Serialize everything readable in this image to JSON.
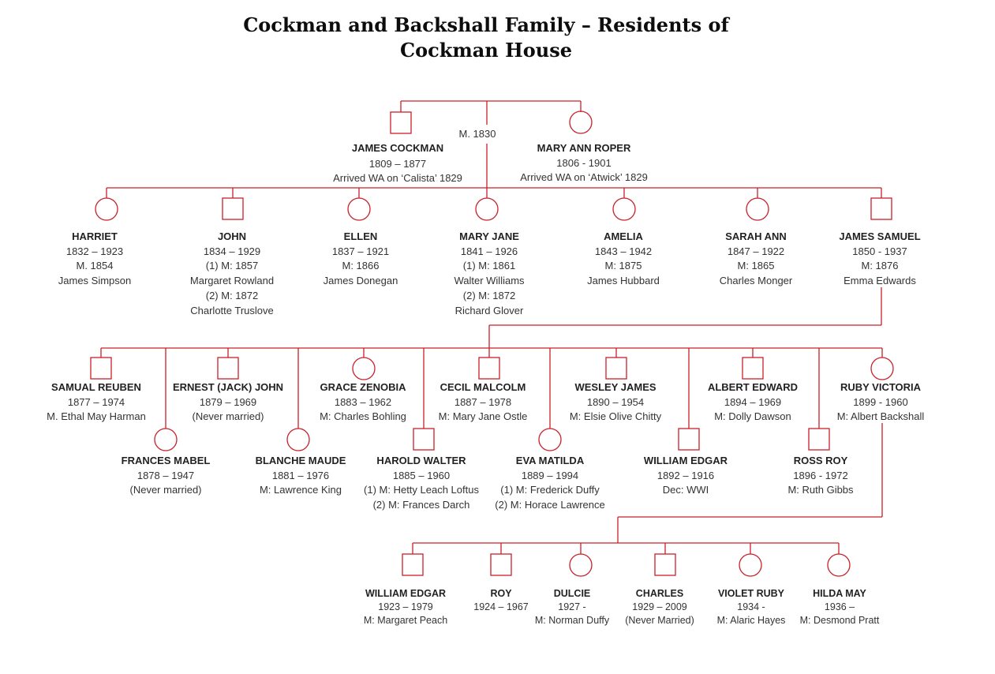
{
  "title_line1": "Cockman and Backshall Family – Residents of",
  "title_line2": "Cockman House",
  "line_color": "#c8202a",
  "founders": {
    "marriage": "M. 1830",
    "husband": {
      "name": "JAMES COCKMAN",
      "sex": "male",
      "lines": [
        "1809 – 1877",
        "Arrived WA on ‘Calista’ 1829"
      ]
    },
    "wife": {
      "name": "MARY ANN ROPER",
      "sex": "female",
      "lines": [
        "1806 - 1901",
        "Arrived WA on ‘Atwick’ 1829"
      ]
    }
  },
  "generation2": [
    {
      "name": "HARRIET",
      "sex": "female",
      "lines": [
        "1832 – 1923",
        "M. 1854",
        "James Simpson"
      ]
    },
    {
      "name": "JOHN",
      "sex": "male",
      "lines": [
        "1834 – 1929",
        "(1) M: 1857",
        "Margaret Rowland",
        "(2) M: 1872",
        "Charlotte Truslove"
      ]
    },
    {
      "name": "ELLEN",
      "sex": "female",
      "lines": [
        "1837 – 1921",
        "M: 1866",
        "James Donegan"
      ]
    },
    {
      "name": "MARY JANE",
      "sex": "female",
      "lines": [
        "1841 – 1926",
        "(1) M: 1861",
        "Walter Williams",
        "(2) M: 1872",
        "Richard Glover"
      ]
    },
    {
      "name": "AMELIA",
      "sex": "female",
      "lines": [
        "1843 – 1942",
        "M: 1875",
        "James Hubbard"
      ]
    },
    {
      "name": "SARAH ANN",
      "sex": "female",
      "lines": [
        "1847 – 1922",
        "M: 1865",
        "Charles Monger"
      ]
    },
    {
      "name": "JAMES SAMUEL",
      "sex": "male",
      "lines": [
        "1850 - 1937",
        "M: 1876",
        "Emma Edwards"
      ]
    }
  ],
  "generation3": [
    {
      "name": "SAMUAL REUBEN",
      "sex": "male",
      "lines": [
        "1877 – 1974",
        "M. Ethal May Harman"
      ]
    },
    {
      "name": "FRANCES MABEL",
      "sex": "female",
      "lines": [
        "1878 – 1947",
        "(Never married)"
      ]
    },
    {
      "name": "ERNEST (JACK) JOHN",
      "sex": "male",
      "lines": [
        "1879 – 1969",
        "(Never married)"
      ]
    },
    {
      "name": "BLANCHE MAUDE",
      "sex": "female",
      "lines": [
        "1881 – 1976",
        "M: Lawrence King"
      ]
    },
    {
      "name": "GRACE ZENOBIA",
      "sex": "female",
      "lines": [
        "1883 – 1962",
        "M: Charles Bohling"
      ]
    },
    {
      "name": "HAROLD WALTER",
      "sex": "male",
      "lines": [
        "1885 – 1960",
        "(1) M: Hetty Leach Loftus",
        "(2) M: Frances Darch"
      ]
    },
    {
      "name": "CECIL MALCOLM",
      "sex": "male",
      "lines": [
        "1887 – 1978",
        "M: Mary Jane Ostle"
      ]
    },
    {
      "name": "EVA MATILDA",
      "sex": "female",
      "lines": [
        "1889 – 1994",
        "(1) M: Frederick Duffy",
        "(2) M: Horace Lawrence"
      ]
    },
    {
      "name": "WESLEY JAMES",
      "sex": "male",
      "lines": [
        "1890 – 1954",
        "M: Elsie Olive Chitty"
      ]
    },
    {
      "name": "WILLIAM EDGAR",
      "sex": "male",
      "lines": [
        "1892 – 1916",
        "Dec: WWI"
      ]
    },
    {
      "name": "ALBERT EDWARD",
      "sex": "male",
      "lines": [
        "1894 – 1969",
        "M: Dolly Dawson"
      ]
    },
    {
      "name": "ROSS ROY",
      "sex": "male",
      "lines": [
        "1896 - 1972",
        "M: Ruth Gibbs"
      ]
    },
    {
      "name": "RUBY VICTORIA",
      "sex": "female",
      "lines": [
        "1899 - 1960",
        "M: Albert Backshall"
      ]
    }
  ],
  "generation4": [
    {
      "name": "WILLIAM EDGAR",
      "sex": "male",
      "lines": [
        "1923 – 1979",
        "M: Margaret Peach"
      ]
    },
    {
      "name": "ROY",
      "sex": "male",
      "lines": [
        "1924 – 1967"
      ]
    },
    {
      "name": "DULCIE",
      "sex": "female",
      "lines": [
        "1927 -",
        "M: Norman Duffy"
      ]
    },
    {
      "name": "CHARLES",
      "sex": "male",
      "lines": [
        "1929 – 2009",
        "(Never Married)"
      ]
    },
    {
      "name": "VIOLET RUBY",
      "sex": "female",
      "lines": [
        "1934 -",
        "M: Alaric Hayes"
      ]
    },
    {
      "name": "HILDA MAY",
      "sex": "female",
      "lines": [
        "1936 –",
        "M: Desmond Pratt"
      ]
    }
  ]
}
